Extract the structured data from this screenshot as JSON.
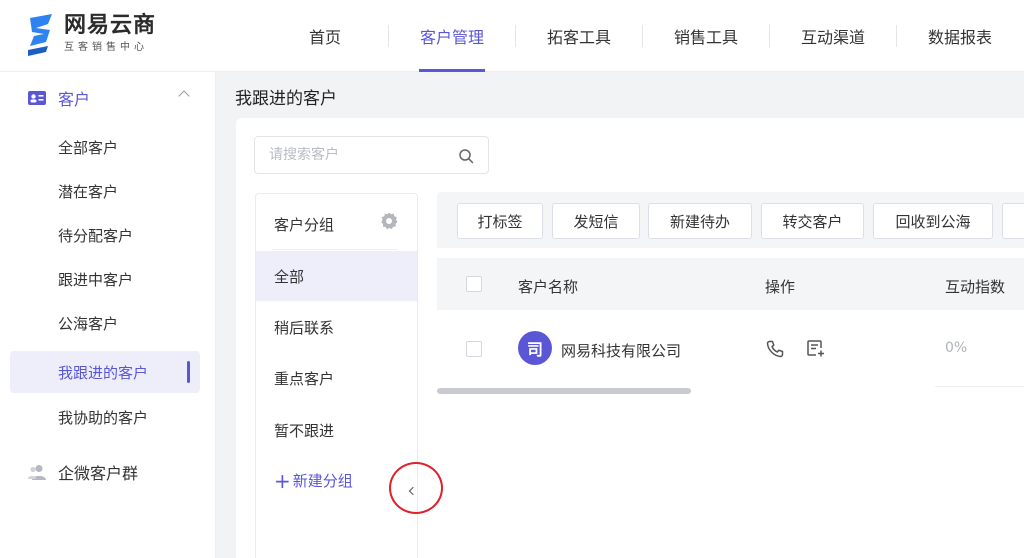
{
  "logo": {
    "title": "网易云商",
    "subtitle": "互客销售中心"
  },
  "nav": {
    "items": [
      {
        "label": "首页"
      },
      {
        "label": "客户管理",
        "active": true
      },
      {
        "label": "拓客工具"
      },
      {
        "label": "销售工具"
      },
      {
        "label": "互动渠道"
      },
      {
        "label": "数据报表"
      }
    ]
  },
  "sidebar": {
    "group_customer": "客户",
    "items": [
      {
        "label": "全部客户"
      },
      {
        "label": "潜在客户"
      },
      {
        "label": "待分配客户"
      },
      {
        "label": "跟进中客户"
      },
      {
        "label": "公海客户"
      },
      {
        "label": "我跟进的客户",
        "active": true
      },
      {
        "label": "我协助的客户"
      }
    ],
    "group_wecom": "企微客户群"
  },
  "page": {
    "title": "我跟进的客户"
  },
  "search": {
    "placeholder": "请搜索客户",
    "value": ""
  },
  "groups": {
    "header": "客户分组",
    "items": [
      {
        "label": "全部",
        "active": true
      },
      {
        "label": "稍后联系"
      },
      {
        "label": "重点客户"
      },
      {
        "label": "暂不跟进"
      }
    ],
    "new_group": "新建分组"
  },
  "toolbar": {
    "buttons": [
      {
        "label": "打标签"
      },
      {
        "label": "发短信"
      },
      {
        "label": "新建待办"
      },
      {
        "label": "转交客户"
      },
      {
        "label": "回收到公海"
      }
    ]
  },
  "table": {
    "headers": {
      "name": "客户名称",
      "actions": "操作",
      "index": "互动指数"
    },
    "rows": [
      {
        "avatar_glyph": "司",
        "name": "网易科技有限公司",
        "interaction_index": "0%"
      }
    ]
  },
  "colors": {
    "accent": "#5a57d6",
    "highlight": "#e0202a"
  }
}
